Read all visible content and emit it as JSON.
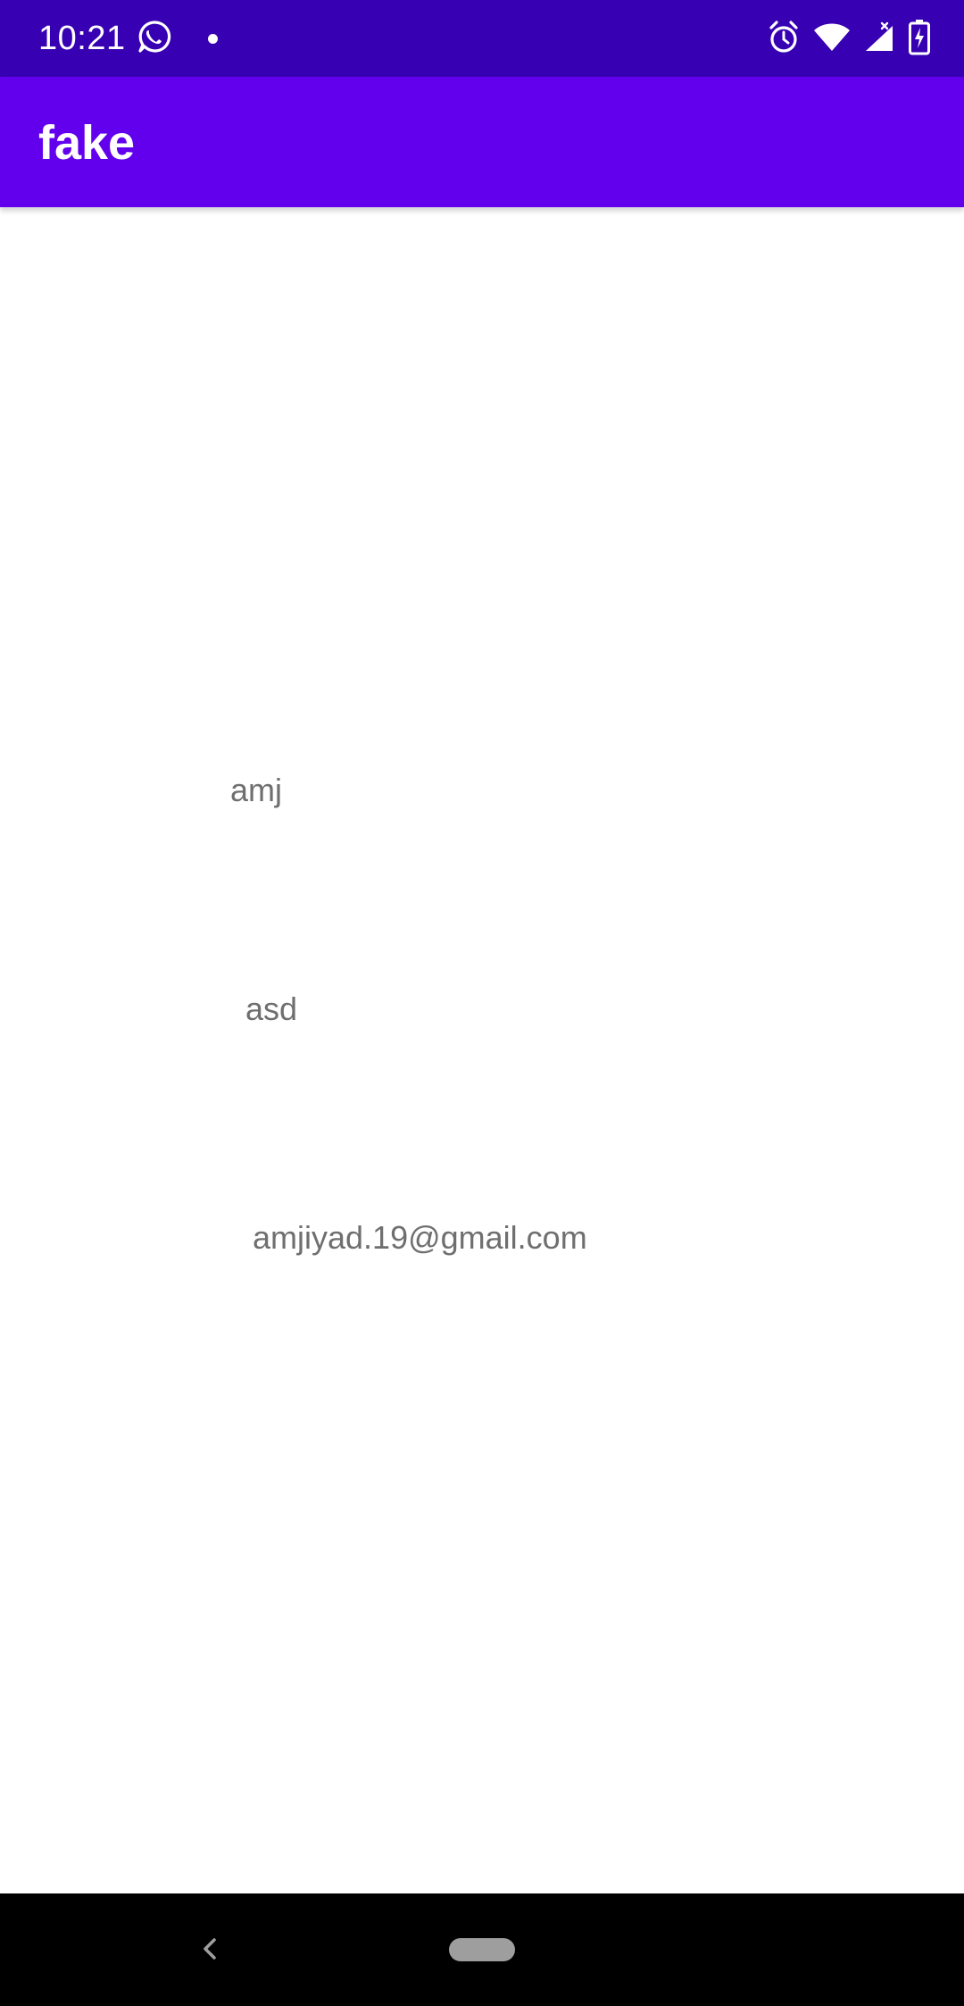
{
  "status_bar": {
    "time": "10:21",
    "left_icons": [
      "whatsapp-icon",
      "notification-dot-icon"
    ],
    "right_icons": [
      "alarm-icon",
      "wifi-icon",
      "cell-signal-icon",
      "battery-charging-icon"
    ],
    "background_color": "#3700b3"
  },
  "app_bar": {
    "title": "fake",
    "background_color": "#6200ee"
  },
  "content": {
    "name_text": "amj",
    "password_text": "asd",
    "email_text": "amjiyad.19@gmail.com",
    "text_color": "#6f6f6f"
  },
  "nav_bar": {
    "icons": [
      "back-icon",
      "home-pill-icon"
    ]
  }
}
